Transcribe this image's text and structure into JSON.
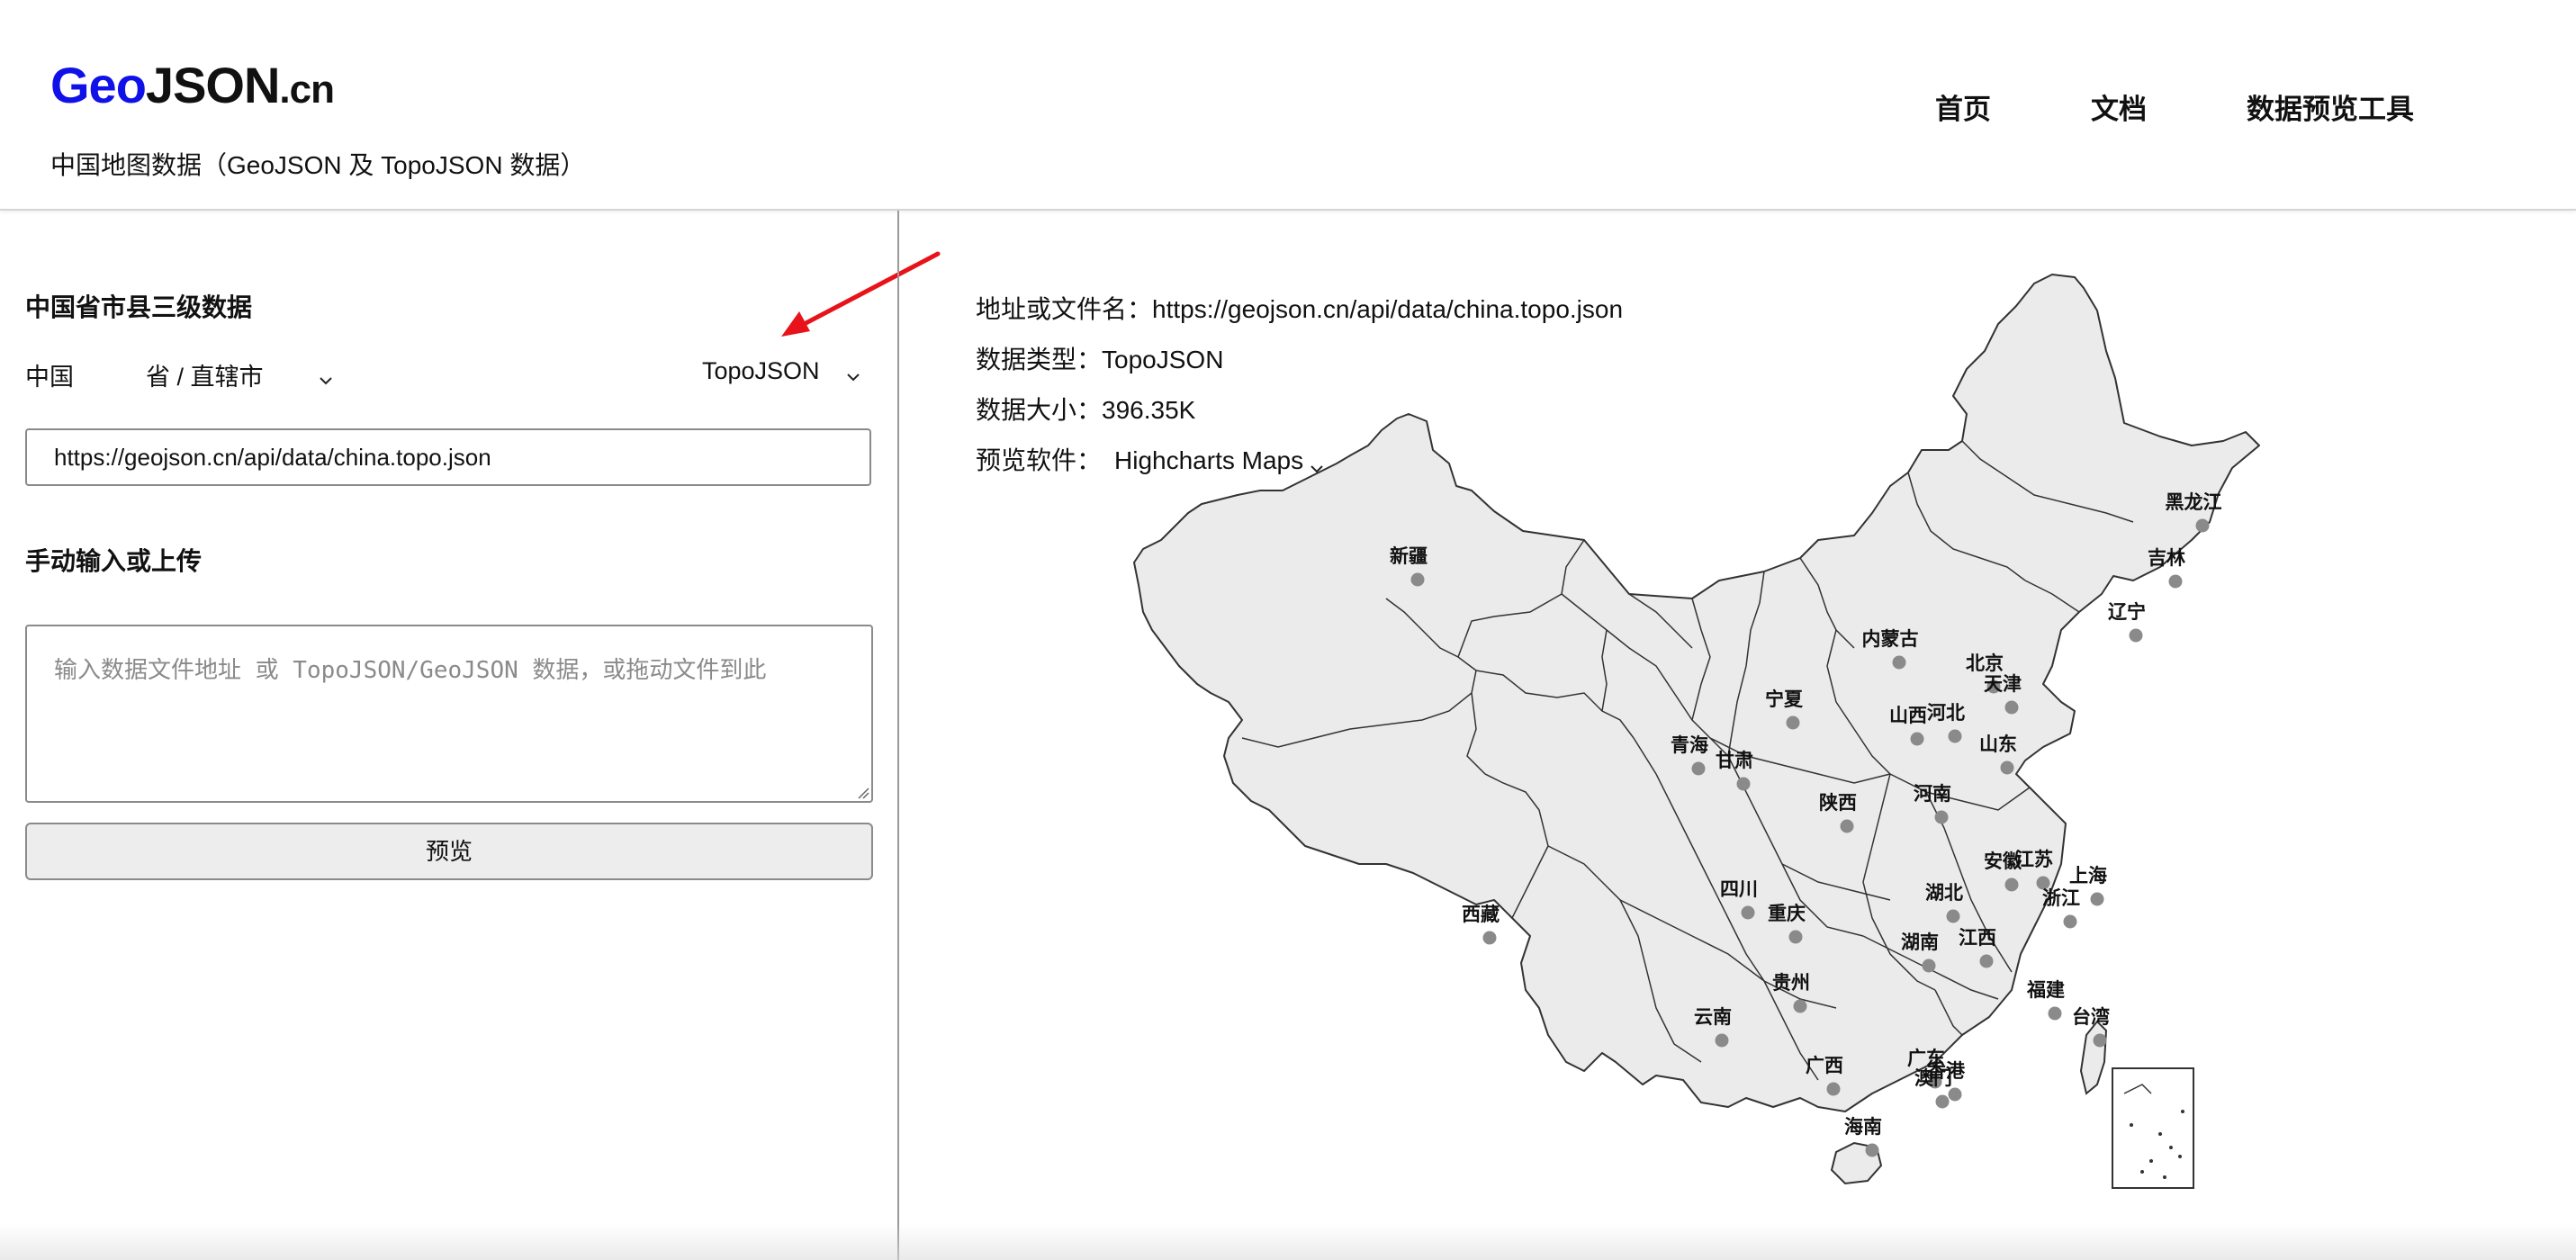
{
  "header": {
    "logo_geo": "Geo",
    "logo_json": "JSON",
    "logo_cn": ".cn",
    "subtitle": "中国地图数据（GeoJSON 及 TopoJSON 数据）",
    "nav": {
      "home": "首页",
      "docs": "文档",
      "tool": "数据预览工具"
    }
  },
  "left_panel": {
    "section1_title": "中国省市县三级数据",
    "country": "中国",
    "province_select": "省 / 直辖市",
    "format_select": "TopoJSON",
    "url_value": "https://geojson.cn/api/data/china.topo.json",
    "section2_title": "手动输入或上传",
    "textarea_placeholder": "输入数据文件地址 或 TopoJSON/GeoJSON 数据，或拖动文件到此",
    "preview_button": "预览"
  },
  "info": {
    "address_label": "地址或文件名：",
    "address_value": "https://geojson.cn/api/data/china.topo.json",
    "type_label": "数据类型：",
    "type_value": "TopoJSON",
    "size_label": "数据大小：",
    "size_value": "396.35K",
    "software_label": "预览软件：",
    "software_value": "Highcharts Maps"
  },
  "map": {
    "fill_color": "#ebebeb",
    "stroke_color": "#333333",
    "dot_color": "#8a8a8a",
    "provinces": [
      {
        "name": "黑龙江"
      },
      {
        "name": "吉林"
      },
      {
        "name": "辽宁"
      },
      {
        "name": "内蒙古"
      },
      {
        "name": "北京"
      },
      {
        "name": "天津"
      },
      {
        "name": "河北"
      },
      {
        "name": "山西"
      },
      {
        "name": "宁夏"
      },
      {
        "name": "青海"
      },
      {
        "name": "甘肃"
      },
      {
        "name": "新疆"
      },
      {
        "name": "山东"
      },
      {
        "name": "陕西"
      },
      {
        "name": "河南"
      },
      {
        "name": "江苏"
      },
      {
        "name": "安徽"
      },
      {
        "name": "上海"
      },
      {
        "name": "四川"
      },
      {
        "name": "湖北"
      },
      {
        "name": "浙江"
      },
      {
        "name": "重庆"
      },
      {
        "name": "西藏"
      },
      {
        "name": "湖南"
      },
      {
        "name": "江西"
      },
      {
        "name": "贵州"
      },
      {
        "name": "福建"
      },
      {
        "name": "云南"
      },
      {
        "name": "台湾"
      },
      {
        "name": "广西"
      },
      {
        "name": "广东"
      },
      {
        "name": "澳门"
      },
      {
        "name": "香港"
      },
      {
        "name": "海南"
      }
    ]
  },
  "accent_arrow_color": "#e8131a"
}
